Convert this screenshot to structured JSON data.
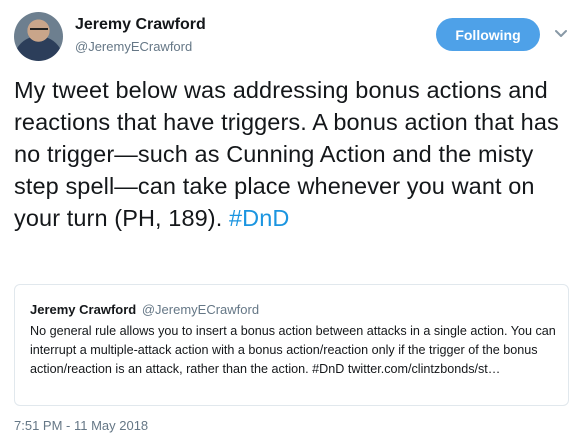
{
  "author": {
    "name": "Jeremy Crawford",
    "handle": "@JeremyECrawford"
  },
  "follow_button": {
    "label": "Following"
  },
  "menu": {
    "icon": "chevron-down-icon"
  },
  "tweet": {
    "text": "My tweet below was addressing bonus actions and reactions that have triggers. A bonus action that has no trigger—such as Cunning Action and the misty step spell—can take place whenever you want on your turn (PH, 189).",
    "hashtag": "#DnD",
    "timestamp": "7:51 PM - 11 May 2018"
  },
  "quoted_tweet": {
    "name": "Jeremy Crawford",
    "handle": "@JeremyECrawford",
    "text": "No general rule allows you to insert a bonus action between attacks in a single action. You can interrupt a multiple-attack action with a bonus action/reaction only if the trigger of the bonus action/reaction is an attack, rather than the action. #DnD twitter.com/clintzbonds/st…"
  },
  "colors": {
    "accent": "#1b95e0",
    "button": "#4ea1e8",
    "secondary_text": "#657786",
    "border": "#e1e8ed"
  }
}
